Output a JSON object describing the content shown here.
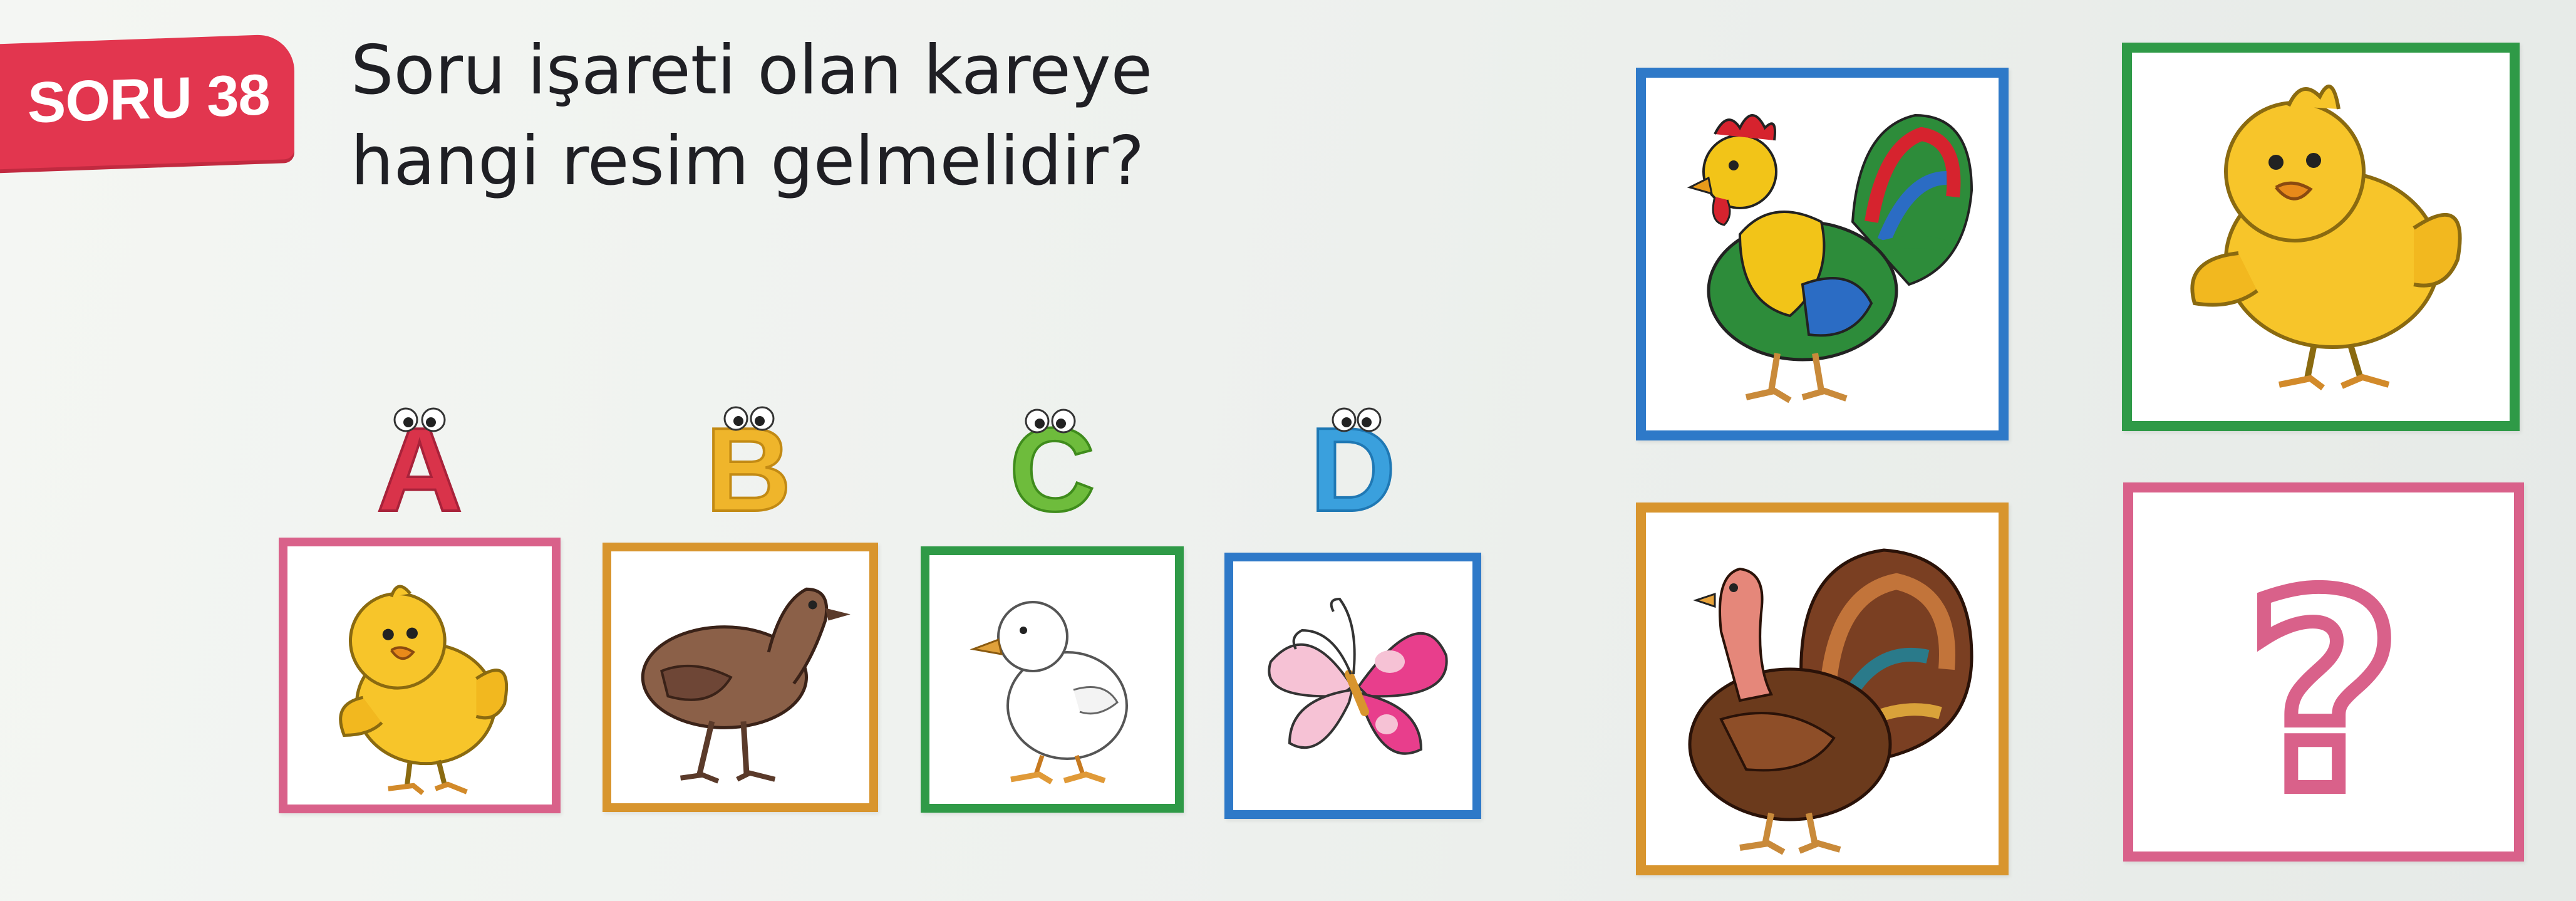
{
  "header": {
    "badge_label": "SORU 38",
    "question_line1": "Soru işareti olan kareye",
    "question_line2": "hangi resim gelmelidir?"
  },
  "options": [
    {
      "letter": "A",
      "animal": "chick-icon",
      "letter_color": "#d9334a",
      "border_color": "#d9618a"
    },
    {
      "letter": "B",
      "animal": "quail-chick-icon",
      "letter_color": "#efb52b",
      "border_color": "#d8952e"
    },
    {
      "letter": "C",
      "animal": "duckling-icon",
      "letter_color": "#6ebc3c",
      "border_color": "#2f9a47"
    },
    {
      "letter": "D",
      "animal": "butterfly-icon",
      "letter_color": "#3aa0dd",
      "border_color": "#2e79c8"
    }
  ],
  "grid": [
    {
      "content": "rooster-icon",
      "border_color": "#2e79c8"
    },
    {
      "content": "chick-icon",
      "border_color": "#2f9a47"
    },
    {
      "content": "turkey-icon",
      "border_color": "#d8952e"
    },
    {
      "content": "question-mark",
      "text": "?",
      "border_color": "#d9618a"
    }
  ]
}
